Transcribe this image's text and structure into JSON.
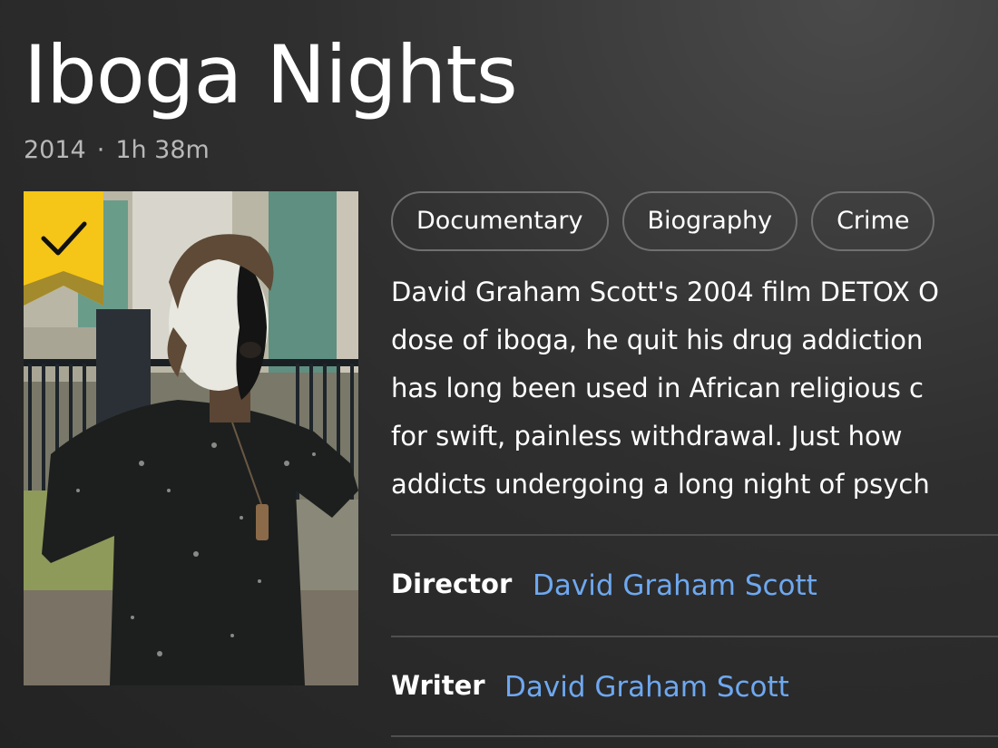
{
  "title": "Iboga Nights",
  "meta": {
    "year": "2014",
    "separator": "·",
    "runtime": "1h 38m"
  },
  "poster": {
    "watchlist_state": "added",
    "ribbon_color": "#f5c518",
    "ribbon_icon": "checkmark-icon"
  },
  "genres": [
    "Documentary",
    "Biography",
    "Crime"
  ],
  "synopsis_lines": [
    "David Graham Scott's 2004 film DETOX O",
    "dose of iboga, he quit his drug addiction",
    "has long been used in African religious c",
    "for swift, painless withdrawal. Just how",
    "addicts undergoing a long night of psych"
  ],
  "credits": [
    {
      "role": "Director",
      "name": "David Graham Scott"
    },
    {
      "role": "Writer",
      "name": "David Graham Scott"
    }
  ],
  "colors": {
    "link": "#6ea8f0",
    "muted_text": "#b8b8b8",
    "chip_border": "#707070",
    "divider": "#4f4f4f"
  }
}
